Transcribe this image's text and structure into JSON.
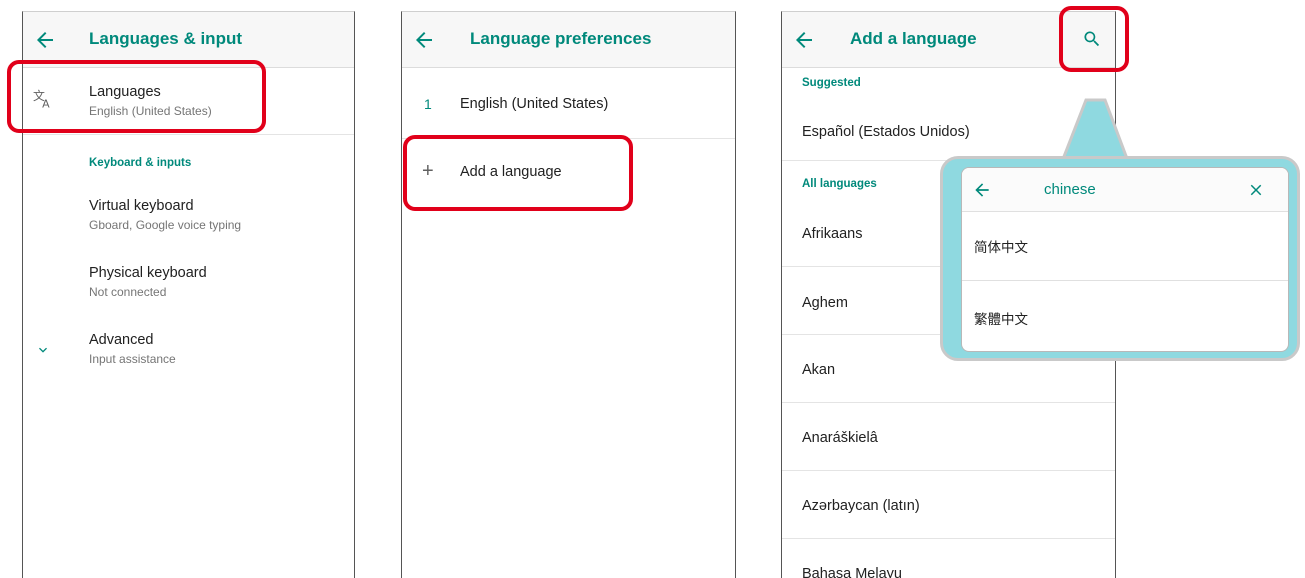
{
  "screen1": {
    "title": "Languages & input",
    "languages": {
      "title": "Languages",
      "subtitle": "English (United States)"
    },
    "section": "Keyboard & inputs",
    "virtual_keyboard": {
      "title": "Virtual keyboard",
      "subtitle": "Gboard, Google voice typing"
    },
    "physical_keyboard": {
      "title": "Physical keyboard",
      "subtitle": "Not connected"
    },
    "advanced": {
      "title": "Advanced",
      "subtitle": "Input assistance"
    }
  },
  "screen2": {
    "title": "Language preferences",
    "items": [
      {
        "index": "1",
        "label": "English (United States)"
      }
    ],
    "add_label": "Add a language",
    "add_glyph": "+"
  },
  "screen3": {
    "title": "Add a language",
    "suggested_header": "Suggested",
    "suggested": [
      "Español (Estados Unidos)"
    ],
    "all_header": "All languages",
    "languages": [
      "Afrikaans",
      "Aghem",
      "Akan",
      "Anaráškielâ",
      "Azərbaycan (latın)",
      "Bahasa Melayu"
    ]
  },
  "search_popup": {
    "query": "chinese",
    "results": [
      "简体中文",
      "繁體中文"
    ]
  },
  "colors": {
    "accent": "#00897b",
    "highlight": "#e1001a",
    "callout": "#8fd9e0"
  },
  "icons": [
    "back-arrow-icon",
    "translate-icon",
    "chevron-down-icon",
    "plus-icon",
    "search-icon",
    "close-icon"
  ]
}
